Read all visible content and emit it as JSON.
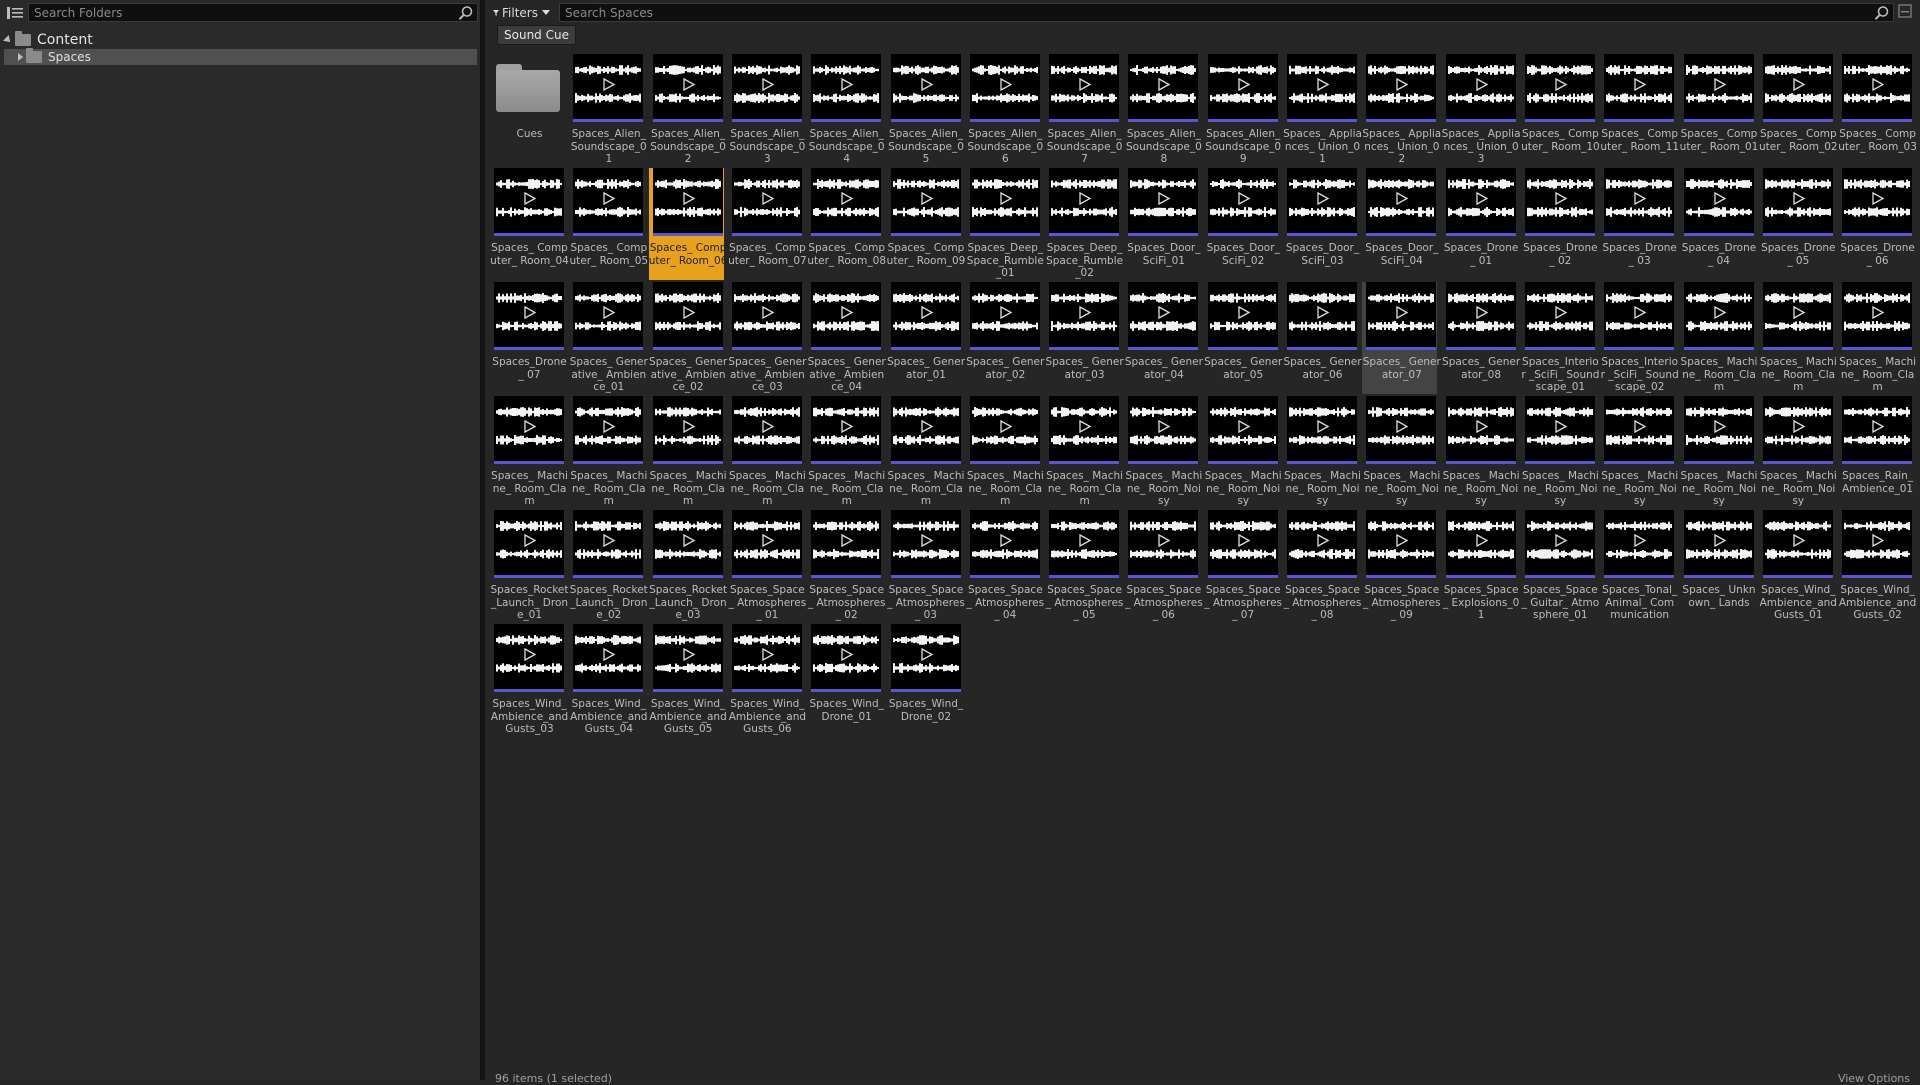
{
  "left_panel": {
    "search_placeholder": "Search Folders",
    "tree_root_label": "Content",
    "tree_child_label": "Spaces"
  },
  "right_panel": {
    "filters_label": "Filters",
    "search_placeholder": "Search Spaces",
    "active_filter": "Sound Cue",
    "status_text": "96 items (1 selected)",
    "view_options_label": "View Options"
  },
  "selected_index": 20,
  "hover_index": 47,
  "assets": [
    "Cues",
    "Spaces_Alien_ Soundscape_01",
    "Spaces_Alien_ Soundscape_02",
    "Spaces_Alien_ Soundscape_03",
    "Spaces_Alien_ Soundscape_04",
    "Spaces_Alien_ Soundscape_05",
    "Spaces_Alien_ Soundscape_06",
    "Spaces_Alien_ Soundscape_07",
    "Spaces_Alien_ Soundscape_08",
    "Spaces_Alien_ Soundscape_09",
    "Spaces_ Appliances_ Union_01",
    "Spaces_ Appliances_ Union_02",
    "Spaces_ Appliances_ Union_03",
    "Spaces_ Computer_ Room_10",
    "Spaces_ Computer_ Room_11",
    "Spaces_ Computer_ Room_01",
    "Spaces_ Computer_ Room_02",
    "Spaces_ Computer_ Room_03",
    "Spaces_ Computer_ Room_04",
    "Spaces_ Computer_ Room_05",
    "Spaces_ Computer_ Room_06",
    "Spaces_ Computer_ Room_07",
    "Spaces_ Computer_ Room_08",
    "Spaces_ Computer_ Room_09",
    "Spaces_Deep_ Space_Rumble _01",
    "Spaces_Deep_ Space_Rumble _02",
    "Spaces_Door_ SciFi_01",
    "Spaces_Door_ SciFi_02",
    "Spaces_Door_ SciFi_03",
    "Spaces_Door_ SciFi_04",
    "Spaces_Drone_ 01",
    "Spaces_Drone_ 02",
    "Spaces_Drone_ 03",
    "Spaces_Drone_ 04",
    "Spaces_Drone_ 05",
    "Spaces_Drone_ 06",
    "Spaces_Drone_ 07",
    "Spaces_ Generative_ Ambience_01",
    "Spaces_ Generative_ Ambience_02",
    "Spaces_ Generative_ Ambience_03",
    "Spaces_ Generative_ Ambience_04",
    "Spaces_ Generator_01",
    "Spaces_ Generator_02",
    "Spaces_ Generator_03",
    "Spaces_ Generator_04",
    "Spaces_ Generator_05",
    "Spaces_ Generator_06",
    "Spaces_ Generator_07",
    "Spaces_ Generator_08",
    "Spaces_Interior _SciFi_ Soundscape_01",
    "Spaces_Interior _SciFi_ Soundscape_02",
    "Spaces_ Machine_ Room_Clam",
    "Spaces_ Machine_ Room_Clam",
    "Spaces_ Machine_ Room_Clam",
    "Spaces_ Machine_ Room_Clam",
    "Spaces_ Machine_ Room_Clam",
    "Spaces_ Machine_ Room_Clam",
    "Spaces_ Machine_ Room_Clam",
    "Spaces_ Machine_ Room_Clam",
    "Spaces_ Machine_ Room_Clam",
    "Spaces_ Machine_ Room_Clam",
    "Spaces_ Machine_ Room_Clam",
    "Spaces_ Machine_ Room_Noisy",
    "Spaces_ Machine_ Room_Noisy",
    "Spaces_ Machine_ Room_Noisy",
    "Spaces_ Machine_ Room_Noisy",
    "Spaces_ Machine_ Room_Noisy",
    "Spaces_ Machine_ Room_Noisy",
    "Spaces_ Machine_ Room_Noisy",
    "Spaces_ Machine_ Room_Noisy",
    "Spaces_ Machine_ Room_Noisy",
    "Spaces_Rain_ Ambience_01",
    "Spaces_Rocket _Launch_ Drone_01",
    "Spaces_Rocket _Launch_ Drone_02",
    "Spaces_Rocket _Launch_ Drone_03",
    "Spaces_Space_ Atmospheres_ 01",
    "Spaces_Space_ Atmospheres_ 02",
    "Spaces_Space_ Atmospheres_ 03",
    "Spaces_Space_ Atmospheres_ 04",
    "Spaces_Space_ Atmospheres_ 05",
    "Spaces_Space_ Atmospheres_ 06",
    "Spaces_Space_ Atmospheres_ 07",
    "Spaces_Space_ Atmospheres_ 08",
    "Spaces_Space_ Atmospheres_ 09",
    "Spaces_Space_ Explosions_01",
    "Spaces_Space_ Guitar_ Atmosphere_01",
    "Spaces_Tonal_ Animal_ Communication",
    "Spaces_ Unknown_ Lands",
    "Spaces_Wind_ Ambience_and Gusts_01",
    "Spaces_Wind_ Ambience_and Gusts_02",
    "Spaces_Wind_ Ambience_and Gusts_03",
    "Spaces_Wind_ Ambience_and Gusts_04",
    "Spaces_Wind_ Ambience_and Gusts_05",
    "Spaces_Wind_ Ambience_and Gusts_06",
    "Spaces_Wind_ Drone_01",
    "Spaces_Wind_ Drone_02"
  ],
  "icons": {
    "panel_toggle": "panel-toggle-icon",
    "search": "search-icon",
    "filter": "funnel-icon",
    "folder": "folder-icon",
    "play": "play-icon"
  },
  "colors": {
    "selection": "#e8a21a",
    "waveform_bar": "#5a55d6",
    "background": "#262626"
  }
}
